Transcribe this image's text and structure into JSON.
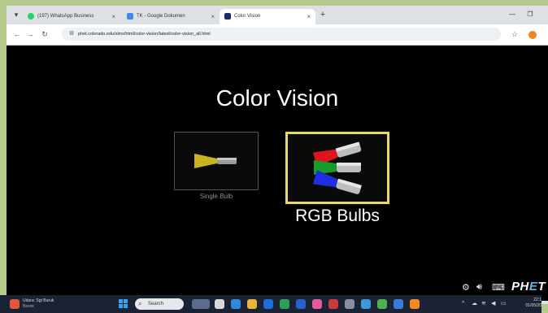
{
  "browser": {
    "tabs": [
      {
        "label": "(197) WhatsApp Business",
        "favicon_color": "#25d366",
        "active": false
      },
      {
        "label": "TK - Google Dokumen",
        "favicon_color": "#4285f4",
        "active": false
      },
      {
        "label": "Color Vision",
        "favicon_color": "#1b2a6b",
        "active": true
      }
    ],
    "address_url": "phet.colorado.edu/sims/html/color-vision/latest/color-vision_all.html"
  },
  "sim": {
    "title": "Color Vision",
    "screens": {
      "single": {
        "label": "Single Bulb"
      },
      "rgb": {
        "label": "RGB Bulbs"
      }
    },
    "brand": {
      "prefix": "PH",
      "e": "E",
      "suffix": "T"
    },
    "colors": {
      "red": "#e0141e",
      "green": "#1a9a2a",
      "blue": "#1f2fe0",
      "yellow": "#c8b41e",
      "selection": "#e8d96b"
    }
  },
  "taskbar": {
    "weather": {
      "line1": "Udara: Sgt Buruk",
      "line2": "Besok"
    },
    "search_label": "Search",
    "clock": {
      "time": "22:1",
      "date": "01/05/20"
    }
  }
}
